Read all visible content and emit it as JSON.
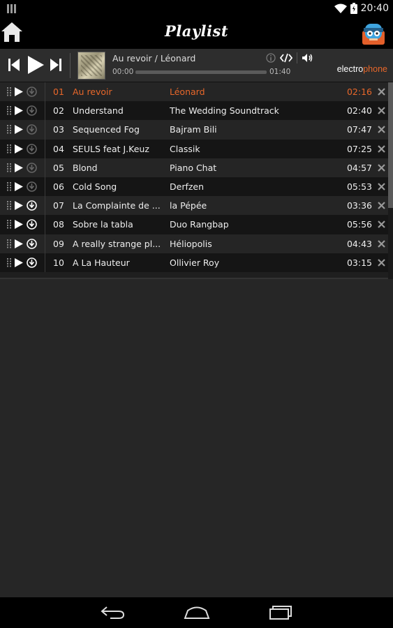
{
  "status_bar": {
    "time": "20:40"
  },
  "action_bar": {
    "title": "Playlist"
  },
  "player": {
    "now_playing": "Au revoir / Léonard",
    "time_current": "00:00",
    "time_total": "01:40",
    "progress_fraction": 0.0,
    "logo_prefix": "electro",
    "logo_suffix": "phone"
  },
  "colors": {
    "accent": "#e8672a",
    "row_odd": "#252525",
    "row_even": "#151515"
  },
  "tracks": [
    {
      "number": "01",
      "title": "Au revoir",
      "artist": "Léonard",
      "duration": "02:16",
      "active": true,
      "downloaded": false
    },
    {
      "number": "02",
      "title": "Understand",
      "artist": "The Wedding Soundtrack",
      "duration": "02:40",
      "active": false,
      "downloaded": false
    },
    {
      "number": "03",
      "title": "Sequenced Fog",
      "artist": "Bajram Bili",
      "duration": "07:47",
      "active": false,
      "downloaded": false
    },
    {
      "number": "04",
      "title": "SEULS feat J.Keuz",
      "artist": "Classik",
      "duration": "07:25",
      "active": false,
      "downloaded": false
    },
    {
      "number": "05",
      "title": "Blond",
      "artist": "Piano Chat",
      "duration": "04:57",
      "active": false,
      "downloaded": false
    },
    {
      "number": "06",
      "title": "Cold Song",
      "artist": "Derfzen",
      "duration": "05:53",
      "active": false,
      "downloaded": false
    },
    {
      "number": "07",
      "title": "La Complainte de ...",
      "artist": "la Pépée",
      "duration": "03:36",
      "active": false,
      "downloaded": true
    },
    {
      "number": "08",
      "title": "Sobre la tabla",
      "artist": "Duo Rangbap",
      "duration": "05:56",
      "active": false,
      "downloaded": true
    },
    {
      "number": "09",
      "title": "A really strange pl...",
      "artist": "Héliopolis",
      "duration": "04:43",
      "active": false,
      "downloaded": true
    },
    {
      "number": "10",
      "title": "A La Hauteur",
      "artist": "Ollivier Roy",
      "duration": "03:15",
      "active": false,
      "downloaded": true
    }
  ],
  "icons": {
    "status": [
      "notification-icon",
      "wifi-icon",
      "battery-icon"
    ],
    "action_bar": [
      "home-icon",
      "avatar-icon"
    ],
    "player": [
      "previous-icon",
      "play-icon",
      "next-icon",
      "info-icon",
      "embed-icon",
      "volume-icon"
    ],
    "row": [
      "drag-handle-icon",
      "play-icon",
      "download-icon",
      "delete-icon"
    ],
    "nav": [
      "back-icon",
      "home-icon",
      "recent-apps-icon"
    ]
  }
}
